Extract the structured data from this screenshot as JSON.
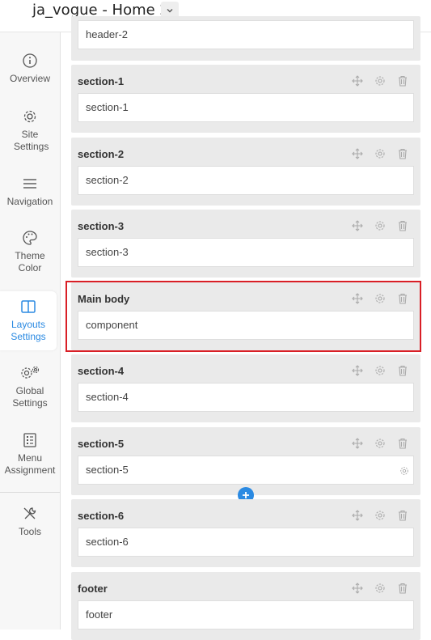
{
  "header": {
    "title": "ja_vogue - Home 2"
  },
  "sidebar": {
    "items": [
      {
        "label": "Overview",
        "icon": "info-icon"
      },
      {
        "label": "Site Settings",
        "icon": "gear-icon"
      },
      {
        "label": "Navigation",
        "icon": "menu-icon"
      },
      {
        "label": "Theme Color",
        "icon": "palette-icon"
      },
      {
        "label": "Layouts Settings",
        "icon": "layout-icon",
        "active": true
      },
      {
        "label": "Global Settings",
        "icon": "gears-icon"
      },
      {
        "label": "Menu Assignment",
        "icon": "list-icon"
      },
      {
        "label": "Tools",
        "icon": "tools-icon"
      }
    ]
  },
  "sections": [
    {
      "title": "",
      "field": "header-2"
    },
    {
      "title": "section-1",
      "field": "section-1"
    },
    {
      "title": "section-2",
      "field": "section-2"
    },
    {
      "title": "section-3",
      "field": "section-3"
    },
    {
      "title": "Main body",
      "field": "component",
      "highlighted": true
    },
    {
      "title": "section-4",
      "field": "section-4"
    },
    {
      "title": "section-5",
      "field": "section-5"
    },
    {
      "title": "section-6",
      "field": "section-6"
    },
    {
      "title": "footer",
      "field": "footer"
    }
  ],
  "colors": {
    "accent": "#2b8ae2",
    "highlight": "#d91f26",
    "section_bg": "#eaeaea"
  }
}
